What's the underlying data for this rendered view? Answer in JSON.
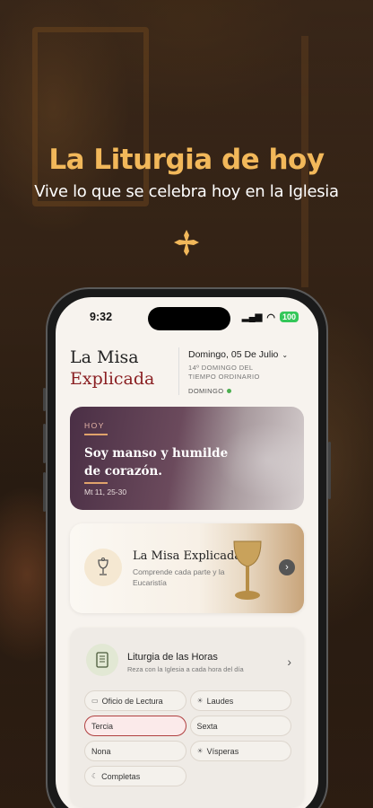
{
  "hero": {
    "title": "La Liturgia de hoy",
    "subtitle": "Vive lo que se celebra hoy en la Iglesia"
  },
  "status_bar": {
    "time": "9:32",
    "battery": "100"
  },
  "header": {
    "brand_line1": "La Misa",
    "brand_line2": "Explicada",
    "date": "Domingo, 05 De Julio",
    "liturgical_time": "14º DOMINGO DEL TIEMPO ORDINARIO",
    "day_label": "DOMINGO"
  },
  "hoy_card": {
    "label": "HOY",
    "text": "Soy manso y humilde de corazón.",
    "reference": "Mt 11, 25-30"
  },
  "misa_card": {
    "title": "La Misa Explicada",
    "subtitle": "Comprende cada parte y la Eucaristía"
  },
  "horas_card": {
    "title": "Liturgia de las Horas",
    "subtitle": "Reza con la Iglesia a cada hora del día",
    "hours": [
      {
        "label": "Oficio de Lectura",
        "icon": "book-icon"
      },
      {
        "label": "Laudes",
        "icon": "sunrise-icon"
      },
      {
        "label": "Tercia",
        "icon": ""
      },
      {
        "label": "Sexta",
        "icon": ""
      },
      {
        "label": "Nona",
        "icon": ""
      },
      {
        "label": "Vísperas",
        "icon": "sunset-icon"
      },
      {
        "label": "Completas",
        "icon": "moon-icon"
      }
    ],
    "selected": "Tercia"
  },
  "colors": {
    "hero_title": "#f2b85a",
    "brand_red": "#8a1f22",
    "active_hour_border": "#b04040"
  }
}
